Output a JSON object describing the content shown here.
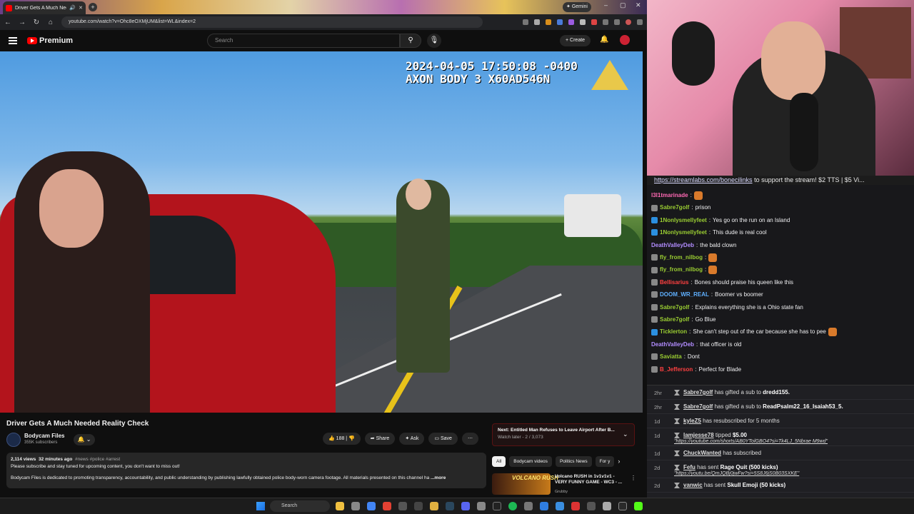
{
  "browser": {
    "tab_title": "Driver Gets A Much Needed",
    "gemini_label": "Gemini",
    "url": "youtube.com/watch?v=Ohc8eOXMjUM&list=WL&index=2"
  },
  "youtube": {
    "logo_text": "Premium",
    "search_placeholder": "Search",
    "create_label": "Create",
    "video": {
      "timestamp_line1": "2024-04-05 17:50:08 -0400",
      "timestamp_line2": "AXON BODY 3 X60AD546N",
      "title": "Driver Gets A Much Needed Reality Check"
    },
    "channel": {
      "name": "Bodycam Files",
      "subscribers": "355K subscribers"
    },
    "actions": {
      "likes": "188",
      "share": "Share",
      "ask": "Ask",
      "save": "Save"
    },
    "description": {
      "views": "2,114 views",
      "age": "32 minutes ago",
      "tags": "#news #police #arrest",
      "line1": "Please subscribe and stay tuned for upcoming content, you don't want to miss out!",
      "line2": "Bodycam Files is dedicated to promoting transparency, accountability, and public understanding by publishing lawfully obtained police body-worn camera footage. All materials presented on this channel ha",
      "more": "...more"
    },
    "up_next": {
      "label": "Next: Entitled Man Refuses to Leave Airport After B...",
      "sub": "Watch later - 2 / 3,073"
    },
    "chips": [
      "All",
      "Bodycam videos",
      "Politics News",
      "For y"
    ],
    "recommendation": {
      "thumb_text": "VOLCANO RUSH",
      "title": "Volcano RUSH in 1v1v1v1 - VERY FUNNY GAME - WC3 - ...",
      "channel": "Grubby"
    }
  },
  "stream": {
    "banner_link": "https://streamlabs.com/bonecilinks",
    "banner_text": " to support the stream! $2 TTS | $5 Vi..."
  },
  "chat": [
    {
      "user": "l3l1tmarinade",
      "color": "#ff69b4",
      "msg": "",
      "badge": "",
      "emote": true
    },
    {
      "user": "Sabre7golf",
      "color": "#9acd32",
      "msg": "prison",
      "badge": "#888",
      "emote": false
    },
    {
      "user": "1Nonlysmellyfeet",
      "color": "#9acd32",
      "msg": "Yes go on the run on an Island",
      "badge": "#2b8fe0",
      "emote": false
    },
    {
      "user": "1Nonlysmellyfeet",
      "color": "#9acd32",
      "msg": "This dude is real cool",
      "badge": "#2b8fe0",
      "emote": false
    },
    {
      "user": "DeathValleyDeb",
      "color": "#b28cff",
      "msg": "the bald clown",
      "badge": "",
      "emote": false
    },
    {
      "user": "fly_from_nilbog",
      "color": "#9acd32",
      "msg": "",
      "badge": "#888",
      "emote": true
    },
    {
      "user": "fly_from_nilbog",
      "color": "#9acd32",
      "msg": "",
      "badge": "#888",
      "emote": true
    },
    {
      "user": "Bellisarius",
      "color": "#ff4040",
      "msg": "Bones should praise his queen like this",
      "badge": "#888",
      "emote": false
    },
    {
      "user": "DOOM_WR_REAL",
      "color": "#5fb0ff",
      "msg": "Boomer vs boomer",
      "badge": "#888",
      "emote": false
    },
    {
      "user": "Sabre7golf",
      "color": "#9acd32",
      "msg": "Explains everything she is a Ohio state fan",
      "badge": "#888",
      "emote": false
    },
    {
      "user": "Sabre7golf",
      "color": "#9acd32",
      "msg": "Go Blue",
      "badge": "#888",
      "emote": false
    },
    {
      "user": "Ticklerton",
      "color": "#9acd32",
      "msg": "She can't step out of the car because she has to pee",
      "badge": "#2b8fe0",
      "emote": true
    },
    {
      "user": "DeathValleyDeb",
      "color": "#b28cff",
      "msg": "that officer is old",
      "badge": "",
      "emote": false
    },
    {
      "user": "Saviatta",
      "color": "#9acd32",
      "msg": "Dont",
      "badge": "#888",
      "emote": false
    },
    {
      "user": "B_Jefferson",
      "color": "#ff4040",
      "msg": "Perfect for Blade",
      "badge": "#888",
      "emote": false
    }
  ],
  "events": [
    {
      "time": "2hr",
      "user": "Sabre7golf",
      "text": " has gifted a sub to ",
      "target": "dredd155.",
      "extra": ""
    },
    {
      "time": "2hr",
      "user": "Sabre7golf",
      "text": " has gifted a sub to ",
      "target": "ReadPsalm22_16_Isaiah53_5.",
      "extra": ""
    },
    {
      "time": "1d",
      "user": "kyleZ5",
      "text": " has resubscribed for 5 months",
      "target": "",
      "extra": ""
    },
    {
      "time": "1d",
      "user": "lamjesse78",
      "text": " tipped ",
      "target": "$5.00",
      "extra": "\"https://youtube.com/shorts/AB0YTolGBO4?si=Tk4LJ_5Nbrae M9wd\""
    },
    {
      "time": "1d",
      "user": "ChuckWanted",
      "text": " has subscribed",
      "target": "",
      "extra": ""
    },
    {
      "time": "2d",
      "user": "Fefu",
      "text": " has sent ",
      "target": "Rage Quit (500 kicks)",
      "extra": "\"https://youtu.be/QmJQBj0jwFw?si=5S8J6jS0B03SXKE\""
    },
    {
      "time": "2d",
      "user": "vanwic",
      "text": " has sent ",
      "target": "Skull Emoji (50 kicks)",
      "extra": ""
    }
  ],
  "taskbar": {
    "search_placeholder": "Search"
  },
  "colors": {
    "yt_red": "#ff0000",
    "chat_bg": "#18181b",
    "dashcam_text": "#ffffff",
    "kick_green": "#8ff068"
  }
}
